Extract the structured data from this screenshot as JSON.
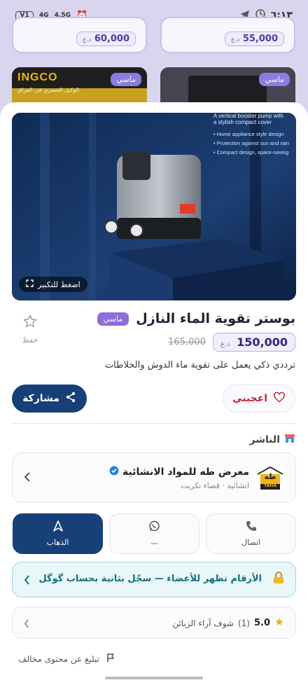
{
  "status_bar": {
    "time": "٦:١٣",
    "battery": "V1",
    "network_a": "4G",
    "network_b": "4.5G"
  },
  "background": {
    "price_left": "60,000",
    "price_right": "55,000",
    "currency": "د.ع",
    "left_badge": "ماسي",
    "right_badge": "ماسي",
    "left_brand": "INGCO",
    "left_tagline": "الوكيل الحصري في العراق"
  },
  "hero": {
    "zoom_label": "اضغط للتكبير",
    "overlay_line1": "A vertical booster pump with",
    "overlay_line2": "a stylish compact cover",
    "bullets": [
      "Home appliance style design",
      "Protection against sun and rain",
      "Compact design, space-saving"
    ]
  },
  "product": {
    "title": "بوستر تقوية الماء النازل",
    "tier": "ماسي",
    "price": "150,000",
    "currency": "د.ع",
    "old_price": "165,000",
    "description": "ترددي ذكي يعمل على تقوية ماء الدوش والخلاطات",
    "save_label": "حفظ",
    "like_label": "اعجبني",
    "share_label": "مشاركة"
  },
  "publisher": {
    "section_title": "الناشر",
    "name": "معرض طه للمواد الانشائية",
    "subtitle": "انشائية · قضاء تكريت",
    "logo_text": "طه",
    "logo_sub": "TAHA"
  },
  "actions": {
    "call": "اتصال",
    "whatsapp": "—",
    "go": "الذهاب"
  },
  "notice": {
    "text": "الأرقام تظهر للأعضاء — سجّل بثانية بحساب گوگل"
  },
  "reviews": {
    "score": "5.0",
    "count": "(1)",
    "label": "شوف آراء الزبائن"
  },
  "report": {
    "label": "تبليغ عن محتوى مخالف"
  },
  "colors": {
    "primary": "#173f78",
    "accent": "#8a6fd8",
    "like": "#c2273b",
    "notice": "#16707c"
  }
}
